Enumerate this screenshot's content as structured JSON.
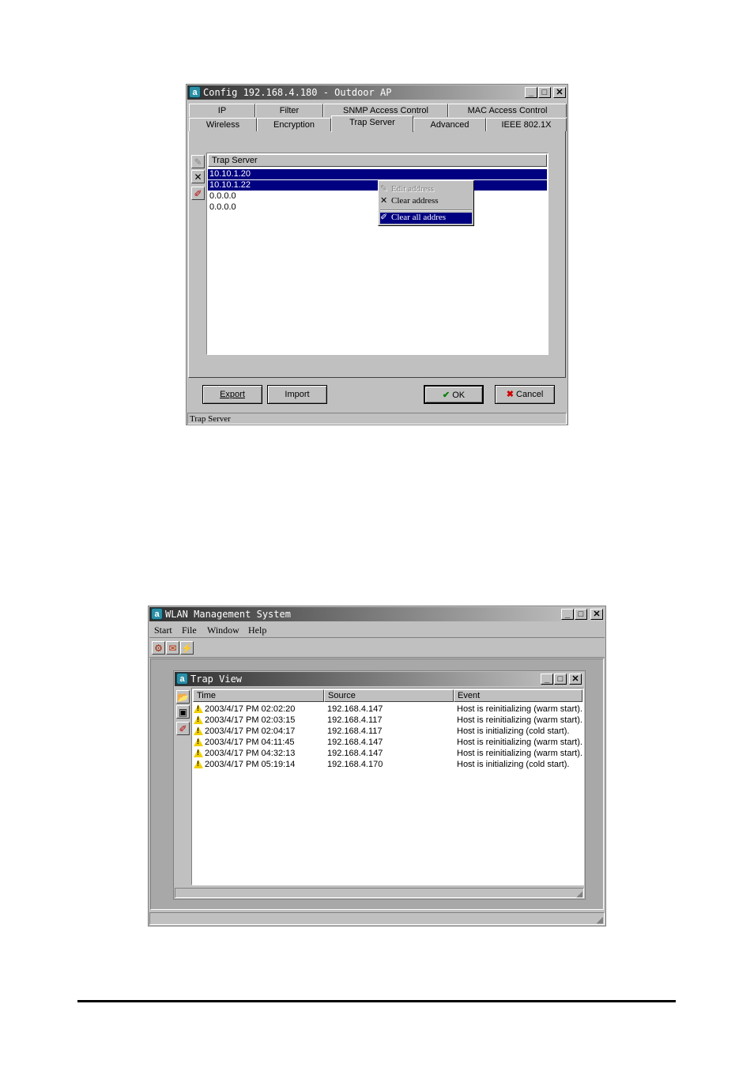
{
  "config_window": {
    "title": "Config 192.168.4.180 - Outdoor AP",
    "tabs_row1": [
      "IP",
      "Filter",
      "SNMP Access Control",
      "MAC Access Control"
    ],
    "tabs_row2": [
      "Wireless",
      "Encryption",
      "Trap Server",
      "Advanced",
      "IEEE 802.1X"
    ],
    "active_tab": "Trap Server",
    "list_header": "Trap Server",
    "addresses": [
      "10.10.1.20",
      "10.10.1.22",
      "0.0.0.0",
      "0.0.0.0"
    ],
    "context_menu": {
      "edit": "Edit address",
      "clear": "Clear address",
      "clear_all": "Clear all addres"
    },
    "buttons": {
      "export": "Export",
      "import": "Import",
      "ok": "OK",
      "cancel": "Cancel"
    },
    "status": "Trap Server"
  },
  "wms_window": {
    "title": "WLAN Management System",
    "menu": [
      "Start",
      "File",
      "Window",
      "Help"
    ],
    "trap_view": {
      "title": "Trap View",
      "columns": [
        "Time",
        "Source",
        "Event"
      ],
      "rows": [
        {
          "time": "2003/4/17 PM 02:02:20",
          "source": "192.168.4.147",
          "event": "Host is reinitializing (warm start)."
        },
        {
          "time": "2003/4/17 PM 02:03:15",
          "source": "192.168.4.117",
          "event": "Host is reinitializing (warm start)."
        },
        {
          "time": "2003/4/17 PM 02:04:17",
          "source": "192.168.4.117",
          "event": "Host is initializing (cold start)."
        },
        {
          "time": "2003/4/17 PM 04:11:45",
          "source": "192.168.4.147",
          "event": "Host is reinitializing (warm start)."
        },
        {
          "time": "2003/4/17 PM 04:32:13",
          "source": "192.168.4.147",
          "event": "Host is reinitializing (warm start)."
        },
        {
          "time": "2003/4/17 PM 05:19:14",
          "source": "192.168.4.170",
          "event": "Host is initializing (cold start)."
        }
      ]
    }
  },
  "colors": {
    "selection": "#000080",
    "face": "#c0c0c0",
    "warning": "#f0d000"
  }
}
